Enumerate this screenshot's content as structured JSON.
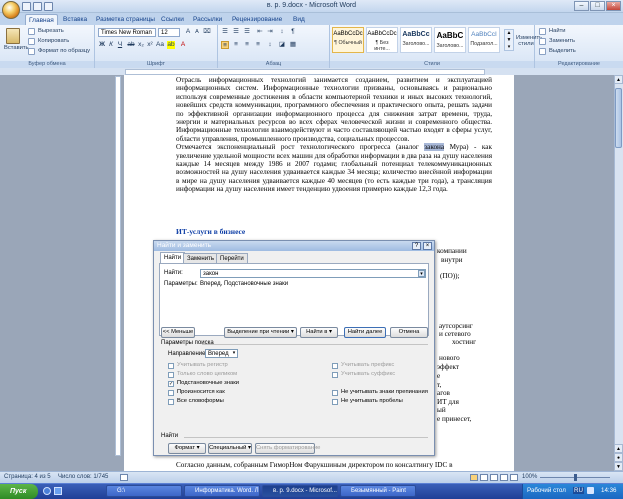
{
  "window": {
    "title": "в. р. 9.docx - Microsoft Word"
  },
  "tabs": [
    "Главная",
    "Вставка",
    "Разметка страницы",
    "Ссылки",
    "Рассылки",
    "Рецензирование",
    "Вид"
  ],
  "ribbon": {
    "clipboard": {
      "paste": "Вставить",
      "cut": "Вырезать",
      "copy": "Копировать",
      "format_painter": "Формат по образцу",
      "label": "Буфер обмена"
    },
    "font": {
      "name": "Times New Roman",
      "size": "12",
      "label": "Шрифт"
    },
    "paragraph": {
      "label": "Абзац"
    },
    "styles": {
      "label": "Стили",
      "items": [
        {
          "preview": "AaBbCcDc",
          "name": "¶ Обычный"
        },
        {
          "preview": "AaBbCcDc",
          "name": "¶ Без инте..."
        },
        {
          "preview": "AaBbCc",
          "name": "Заголово..."
        },
        {
          "preview": "AaBbC",
          "name": "Заголово..."
        },
        {
          "preview": "AaBbCcI",
          "name": "Подзагол..."
        }
      ],
      "change": "Изменить стили"
    },
    "editing": {
      "find": "Найти",
      "replace": "Заменить",
      "select": "Выделить",
      "label": "Редактирование"
    }
  },
  "document": {
    "paragraphs": [
      "Отрасль информационных технологий занимается созданием, развитием и эксплуатацией информационных систем. Информационные технологии призваны, основываясь и рационально используя современные достижения в области компьютерной техники и иных высоких технологий, новейших средств коммуникации, программного обеспечения и практического опыта, решать задачи по эффективной организации информационного процесса для снижения затрат времени, труда, энергии и материальных ресурсов во всех сферах человеческой жизни и современного общества. Информационные технологии взаимодействуют и часто составляющей частью входят в сферы услуг, области управления, промышленного производства, социальных процессов."
    ],
    "para2_before": "Отмечается экспоненциальный рост технологического прогресса (аналог ",
    "para2_highlight": "закона",
    "para2_after": " Мура) - как увеличение удельной мощности всех машин для обработки информации в два раза на душу населения каждые 14 месяцев между 1986 и 2007 годами; глобальный потенциал телекоммуникационных возможностей на душу населения удваивается каждые 34 месяца; количество внесённой информации в мире на душу населения удваивается каждые 40 месяцев (то есть каждые три года), а трансляция информации на душу населения имеет тенденцию удвоения примерно каждые 12,3 года.",
    "heading": "ИТ-услуги в бизнесе",
    "right_fragments": [
      "компании",
      "внутри",
      "(ПО));",
      "аутсорсинг",
      "и сетевого",
      "хостинг",
      "нового",
      "эффект",
      "е",
      "т,",
      "агов",
      "ИТ для",
      "ый",
      "е принесет,"
    ],
    "bottom_line": "Согласно данным, собранным ГиморНом Фарукшиным директором по консалтингу IDC в"
  },
  "dialog": {
    "title": "Найти и заменить",
    "tabs": [
      "Найти",
      "Заменить",
      "Перейти"
    ],
    "find_label": "Найти:",
    "find_value": "закон",
    "params_label": "Параметры:",
    "params_value": "Вперед, Подстановочные знаки",
    "buttons": {
      "less": "<< Меньше",
      "highlight": "Выделение при чтении ▾",
      "find_in": "Найти в ▾",
      "find_next": "Найти далее",
      "cancel": "Отмена"
    },
    "search_params_label": "Параметры поиска",
    "direction_label": "Направление:",
    "direction_value": "Вперед",
    "options_left": [
      {
        "label": "Учитывать регистр",
        "checked": false,
        "disabled": true
      },
      {
        "label": "Только слово целиком",
        "checked": false,
        "disabled": true
      },
      {
        "label": "Подстановочные знаки",
        "checked": true,
        "disabled": false
      },
      {
        "label": "Произносится как",
        "checked": false,
        "disabled": false
      },
      {
        "label": "Все словоформы",
        "checked": false,
        "disabled": false
      }
    ],
    "options_right": [
      {
        "label": "Учитывать префикс",
        "checked": false,
        "disabled": true
      },
      {
        "label": "Учитывать суффикс",
        "checked": false,
        "disabled": true
      },
      {
        "label": "Не учитывать знаки препинания",
        "checked": false,
        "disabled": false
      },
      {
        "label": "Не учитывать пробелы",
        "checked": false,
        "disabled": false
      }
    ],
    "find_section": "Найти",
    "bottom_buttons": {
      "format": "Формат ▾",
      "special": "Специальный ▾",
      "clear": "Снять форматирование"
    }
  },
  "status": {
    "page": "Страница: 4 из 5",
    "words": "Число слов: 1/745",
    "zoom": "100%"
  },
  "taskbar": {
    "start": "Пуск",
    "tasks": [
      "G:\\",
      "Информатика. Word. Л...",
      "в. р. 9.docx - Microsof...",
      "Безымянный - Paint"
    ],
    "active_index": 2,
    "desktop": "Рабочий стол",
    "lang": "RU",
    "time": "14:36"
  }
}
